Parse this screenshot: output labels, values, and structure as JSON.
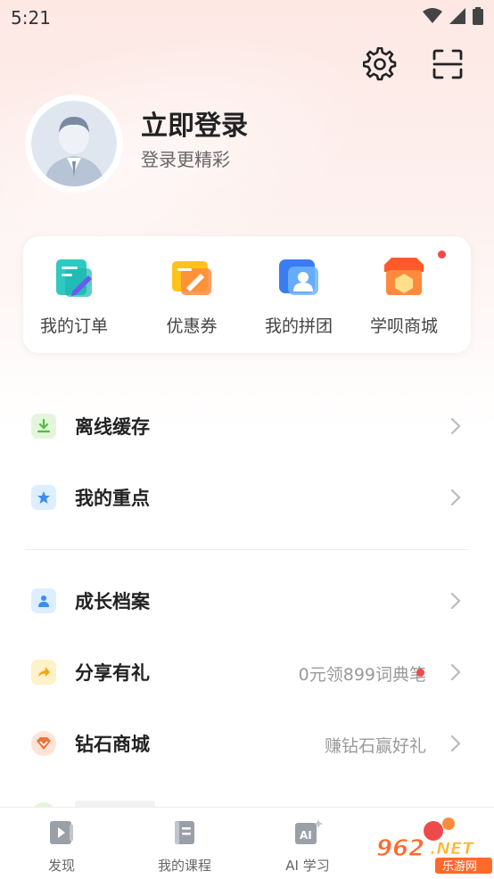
{
  "status_bar": {
    "time": "5:21"
  },
  "header": {
    "login_title": "立即登录",
    "login_subtitle": "登录更精彩"
  },
  "quick_actions": [
    {
      "label": "我的订单",
      "icon": "orders-icon"
    },
    {
      "label": "优惠券",
      "icon": "coupon-icon"
    },
    {
      "label": "我的拼团",
      "icon": "group-buy-icon"
    },
    {
      "label": "学呗商城",
      "icon": "mall-icon",
      "badge": true
    }
  ],
  "menu": [
    {
      "label": "离线缓存",
      "icon": "download-icon",
      "extra": ""
    },
    {
      "label": "我的重点",
      "icon": "star-icon",
      "extra": ""
    },
    {
      "label": "成长档案",
      "icon": "profile-icon",
      "extra": ""
    },
    {
      "label": "分享有礼",
      "icon": "share-icon",
      "extra": "0元领899词典笔",
      "badge": true
    },
    {
      "label": "钻石商城",
      "icon": "diamond-icon",
      "extra": "赚钻石赢好礼"
    }
  ],
  "tabbar": [
    {
      "label": "发现",
      "icon": "discover-icon"
    },
    {
      "label": "我的课程",
      "icon": "courses-icon"
    },
    {
      "label": "AI 学习",
      "icon": "ai-learning-icon"
    }
  ],
  "watermark": {
    "text": "962.NET",
    "sub": "乐游网"
  },
  "colors": {
    "accent_red": "#ef4a4a",
    "header_bg": "#fde8e4",
    "download_green": "#4fbf3a",
    "star_blue": "#3b8df0",
    "share_yellow": "#f2a413",
    "diamond_orange": "#f0713a"
  }
}
